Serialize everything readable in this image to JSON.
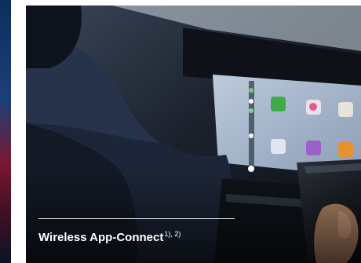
{
  "caption": {
    "title": "Wireless App-Connect",
    "footnotes": "1), 2)"
  },
  "colors": {
    "left_strip_top": "#1b3f78",
    "left_strip_mid": "#7a1832",
    "screen_background": "#8fa3bd",
    "caption_text": "#ffffff"
  },
  "icons": [
    "carplay-icon-green",
    "carplay-icon-colorful",
    "carplay-icon-purple",
    "carplay-icon-orange",
    "carplay-icon-photo",
    "carplay-icon-blue"
  ]
}
